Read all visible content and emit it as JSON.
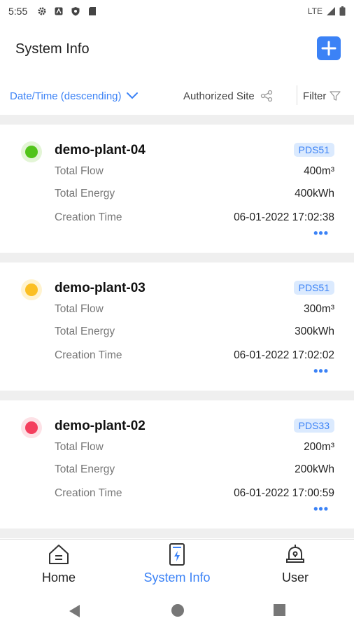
{
  "statusbar": {
    "time": "5:55",
    "network": "LTE"
  },
  "appbar": {
    "title": "System Info"
  },
  "filterbar": {
    "sort_label": "Date/Time (descending)",
    "site_label": "Authorized Site",
    "filter_label": "Filter"
  },
  "cards": [
    {
      "name": "demo-plant-04",
      "badge": "PDS51",
      "status_color": "#52c41a",
      "status_glow": "#e3f5d6",
      "rows": [
        {
          "label": "Total Flow",
          "value": "400m³"
        },
        {
          "label": "Total Energy",
          "value": "400kWh"
        },
        {
          "label": "Creation Time",
          "value": "06-01-2022 17:02:38"
        }
      ],
      "more": "•••"
    },
    {
      "name": "demo-plant-03",
      "badge": "PDS51",
      "status_color": "#fbbf24",
      "status_glow": "#fff3cf",
      "rows": [
        {
          "label": "Total Flow",
          "value": "300m³"
        },
        {
          "label": "Total Energy",
          "value": "300kWh"
        },
        {
          "label": "Creation Time",
          "value": "06-01-2022 17:02:02"
        }
      ],
      "more": "•••"
    },
    {
      "name": "demo-plant-02",
      "badge": "PDS33",
      "status_color": "#f43f5e",
      "status_glow": "#fde1e6",
      "rows": [
        {
          "label": "Total Flow",
          "value": "200m³"
        },
        {
          "label": "Total Energy",
          "value": "200kWh"
        },
        {
          "label": "Creation Time",
          "value": "06-01-2022 17:00:59"
        }
      ],
      "more": "•••"
    }
  ],
  "bottomnav": {
    "items": [
      {
        "label": "Home",
        "icon": "home-icon"
      },
      {
        "label": "System Info",
        "icon": "device-bolt-icon",
        "active": true
      },
      {
        "label": "User",
        "icon": "user-bell-icon"
      }
    ]
  },
  "colors": {
    "accent": "#3b82f6"
  }
}
